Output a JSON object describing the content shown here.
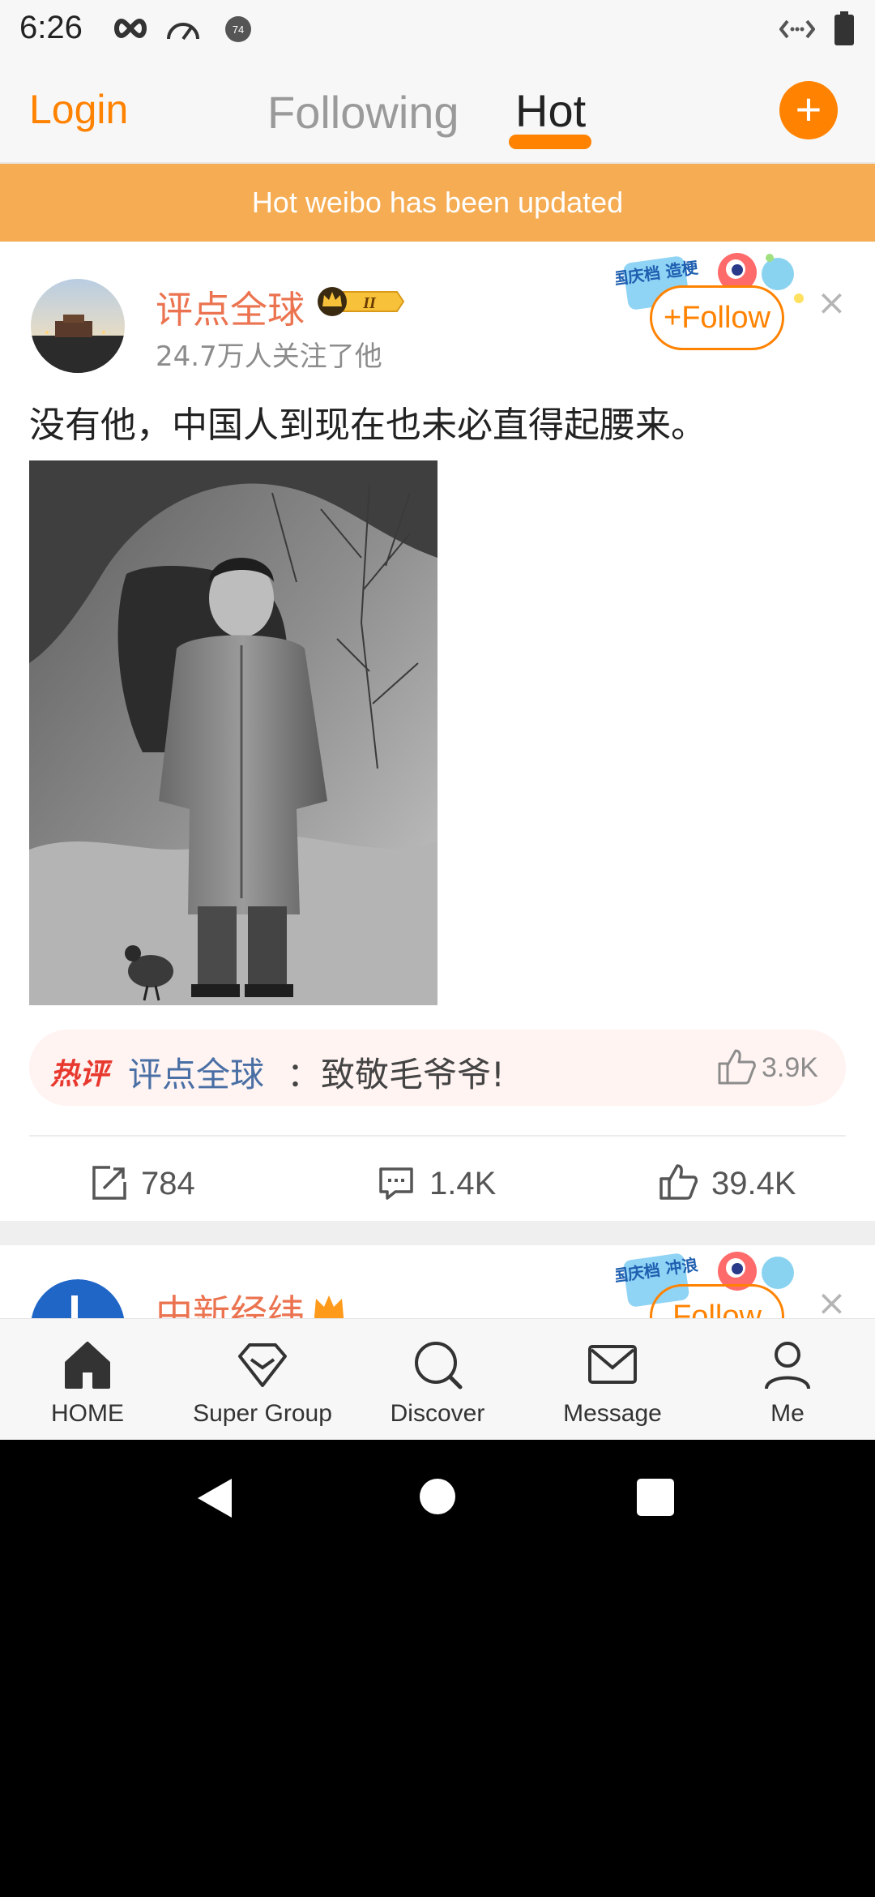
{
  "status_bar": {
    "time": "6:26",
    "badge_number": "74",
    "icons": [
      "infinity-icon",
      "speedometer-icon",
      "notification-badge-icon",
      "code-arrows-icon",
      "battery-icon"
    ]
  },
  "top_nav": {
    "login_label": "Login",
    "tabs": [
      {
        "label": "Following",
        "active": false
      },
      {
        "label": "Hot",
        "active": true
      }
    ],
    "add_label": "+"
  },
  "banner": {
    "text": "Hot weibo has been updated"
  },
  "post": {
    "author": "评点全球",
    "vip_level": "II",
    "followers": "24.7万人关注了他",
    "follow_label": "Follow",
    "follow_plus": "+",
    "close_label": "×",
    "text": "没有他，中国人到现在也未必直得起腰来。",
    "sticker_text": "国庆档 造梗",
    "hot_comment": {
      "tag": "热评",
      "author": "评点全球",
      "text": "：致敬毛爷爷!",
      "likes": "3.9K"
    },
    "actions": {
      "reposts": "784",
      "comments": "1.4K",
      "likes": "39.4K"
    }
  },
  "next_post": {
    "author": "中新经纬",
    "sticker_text": "国庆档 冲浪",
    "follow_label": "Follow",
    "close_label": "×"
  },
  "bottom_nav": {
    "items": [
      {
        "label": "HOME",
        "icon": "home-icon"
      },
      {
        "label": "Super Group",
        "icon": "diamond-icon"
      },
      {
        "label": "Discover",
        "icon": "search-icon"
      },
      {
        "label": "Message",
        "icon": "envelope-icon"
      },
      {
        "label": "Me",
        "icon": "person-icon"
      }
    ]
  },
  "colors": {
    "accent": "#ff8200",
    "banner": "#f5ac52",
    "author_name": "#eb7350",
    "link_blue": "#4a6fa5"
  }
}
